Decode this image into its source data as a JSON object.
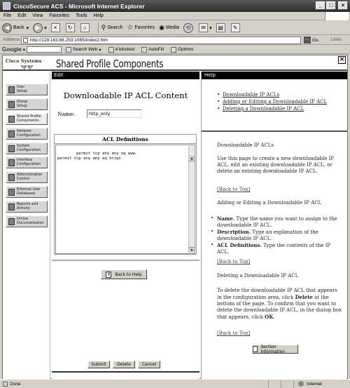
{
  "window": {
    "title": "CiscoSecure ACS - Microsoft Internet Explorer"
  },
  "menu": [
    "File",
    "Edit",
    "View",
    "Favorites",
    "Tools",
    "Help"
  ],
  "toolbar": {
    "back": "Back",
    "search": "Search",
    "favorites": "Favorites",
    "media": "Media"
  },
  "address": {
    "label": "Address",
    "url": "http://128.163.88.253:1065/index2.htm",
    "go": "Go",
    "links": "Links"
  },
  "googlebar": {
    "logo": "Google",
    "search_web": "Search Web",
    "blocked": "4 blocked",
    "autofill": "AutoFill",
    "options": "Options"
  },
  "header": {
    "logo": "Cisco Systems",
    "title": "Shared Profile Components"
  },
  "nav": [
    {
      "label": "User Setup",
      "lines": [
        "User",
        "Setup"
      ]
    },
    {
      "label": "Group Setup",
      "lines": [
        "Group",
        "Setup"
      ]
    },
    {
      "label": "Shared Profile Components",
      "lines": [
        "Shared Profile",
        "Components"
      ]
    },
    {
      "label": "Network Configuration",
      "lines": [
        "Network",
        "Configuration"
      ]
    },
    {
      "label": "System Configuration",
      "lines": [
        "System",
        "Configuration"
      ]
    },
    {
      "label": "Interface Configuration",
      "lines": [
        "Interface",
        "Configuration"
      ]
    },
    {
      "label": "Administration Control",
      "lines": [
        "Administration",
        "Control"
      ]
    },
    {
      "label": "External User Databases",
      "lines": [
        "External User",
        "Databases"
      ]
    },
    {
      "label": "Reports and Activity",
      "lines": [
        "Reports and",
        "Activity"
      ]
    },
    {
      "label": "Online Documentation",
      "lines": [
        "Online",
        "Documentation"
      ]
    }
  ],
  "edit": {
    "header": "Edit",
    "title": "Downloadable IP ACL Content",
    "name_label": "Name:",
    "name_value": "http_only",
    "acl_header": "ACL Definitions",
    "acl_text": "permit tcp any any eq www\npermit tcp any any eq https",
    "back_to_help": "Back to Help",
    "submit": "Submit",
    "delete": "Delete",
    "cancel": "Cancel"
  },
  "help": {
    "header": "Help",
    "links": [
      "Downloadable IP ACLs",
      "Adding or Editing a Downloadable IP ACL",
      "Deleting a Downloadable IP ACL"
    ],
    "s1_title": "Downloadable IP ACLs",
    "s1_text": "Use this page to create a new downloadable IP ACL, edit an existing downloadable IP ACL, or delete an existing downloadable IP ACL.",
    "back_to_top": "[Back to Top]",
    "s2_title": "Adding or Editing a Downloadable IP ACL",
    "s2_items": [
      {
        "term": "Name.",
        "text": "Type the name you want to assign to the downloadable IP ACL."
      },
      {
        "term": "Description.",
        "text": "Type an explanation of the downloadable IP ACL."
      },
      {
        "term": "ACL Definitions.",
        "text": "Type the contents of the IP ACL."
      }
    ],
    "s3_title": "Deleting a Downloadable IP ACL",
    "s3_p1": "To delete the downloadable IP ACL that appears in the configuration area, click ",
    "s3_delete": "Delete",
    "s3_p2": " at the bottom of the page. To confirm that you want to delete the downloadable IP ACL, in the dialog box that appears, click ",
    "s3_ok": "OK",
    "s3_p3": ".",
    "section_info": "Section Information"
  },
  "status": {
    "left": "Done",
    "zone": "Internet"
  }
}
